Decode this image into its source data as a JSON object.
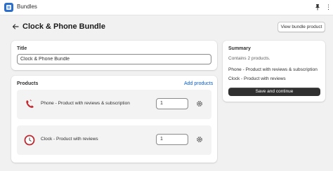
{
  "app": {
    "name": "Bundles",
    "icon": "bundles-app-icon"
  },
  "header": {
    "title": "Clock & Phone Bundle",
    "back_icon": "arrow-left-icon",
    "view_button": "View bundle product"
  },
  "title_card": {
    "heading": "Title",
    "value": "Clock & Phone Bundle"
  },
  "products_card": {
    "heading": "Products",
    "add_link": "Add products",
    "items": [
      {
        "name": "Phone - Product with reviews & subscription",
        "quantity": "1",
        "image": "phone-icon"
      },
      {
        "name": "Clock - Product with reviews",
        "quantity": "1",
        "image": "clock-icon"
      }
    ]
  },
  "summary": {
    "heading": "Summary",
    "count_text": "Contains 2 products.",
    "items": [
      "Phone - Product with reviews & subscription",
      "Clock - Product with reviews"
    ],
    "save_button": "Save and continue"
  },
  "colors": {
    "accent_link": "#005bd3",
    "primary_button": "#303030",
    "background": "#f1f1f1"
  }
}
